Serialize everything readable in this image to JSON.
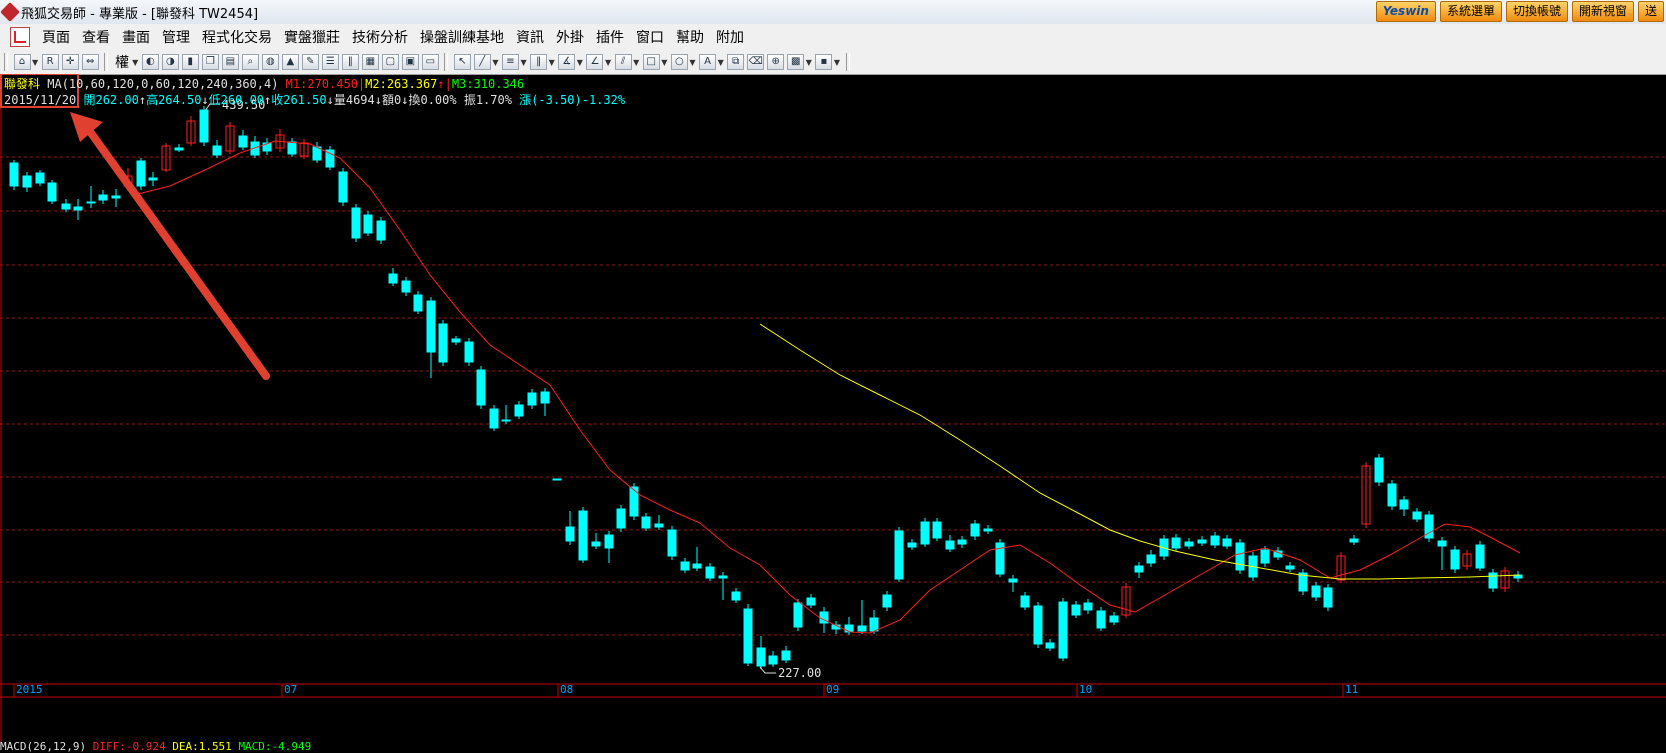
{
  "window": {
    "title": "飛狐交易師 - 專業版 - [聯發科 TW2454]",
    "buttons": [
      "Yeswin",
      "系統選單",
      "切換帳號",
      "開新視窗",
      "送"
    ]
  },
  "menu": [
    "頁面",
    "查看",
    "畫面",
    "管理",
    "程式化交易",
    "實盤獵莊",
    "技術分析",
    "操盤訓練基地",
    "資訊",
    "外掛",
    "插件",
    "窗口",
    "幫助",
    "附加"
  ],
  "toolbar": {
    "weight_label": "權"
  },
  "header": {
    "stock_name": "聯發科",
    "ma_label": "MA(10,60,120,0,60,120,240,360,4)",
    "m1": "M1:270.450",
    "m2": "M2:263.367",
    "m2_arrow": "↑",
    "m3": "M3:310.346",
    "date": "2015/11/20",
    "open": "開262.00",
    "high": "高264.50",
    "low": "低260.00",
    "close": "收261.50",
    "volume": "量4694",
    "amount": "額0",
    "turnover": "換0.00%",
    "amplitude": "振1.70%",
    "change": "漲(-3.50)-1.32%"
  },
  "price_labels": {
    "high": "439.50",
    "low": "227.00"
  },
  "x_axis": [
    "2015",
    "07",
    "08",
    "09",
    "10",
    "11"
  ],
  "macd": {
    "label": "MACD(26,12,9)",
    "diff": "DIFF:-0.924",
    "dea": "DEA:1.551",
    "macd": "MACD:-4.949"
  },
  "colors": {
    "up": "#ff2020",
    "down": "#00ffff",
    "ma1": "#ff2020",
    "ma2": "#ffff00",
    "grid": "#8b1a1a",
    "axis": "#c80000",
    "highlight": "#e04030"
  }
}
